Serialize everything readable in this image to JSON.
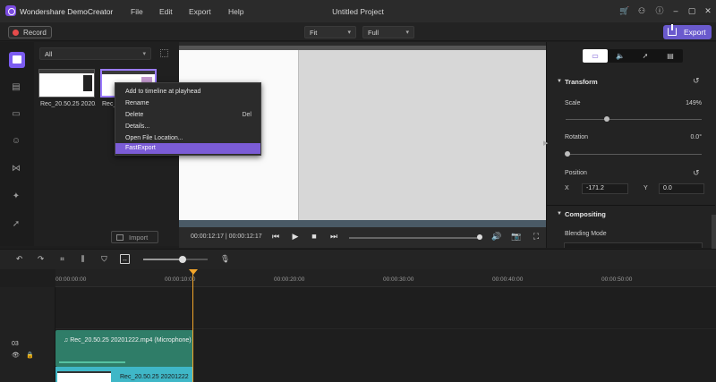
{
  "app": {
    "name": "Wondershare DemoCreator",
    "project_title": "Untitled Project"
  },
  "menu": [
    "File",
    "Edit",
    "Export",
    "Help"
  ],
  "toolbar": {
    "record_label": "Record",
    "fit_value": "Fit",
    "full_value": "Full",
    "export_label": "Export"
  },
  "media": {
    "filter_value": "All",
    "items": [
      {
        "label": "Rec_20.50.25 2020..."
      },
      {
        "label": "Rec_20.50.25 2020..."
      }
    ],
    "import_label": "Import"
  },
  "context_menu": {
    "items": [
      {
        "label": "Add to timeline at playhead",
        "shortcut": ""
      },
      {
        "label": "Rename",
        "shortcut": ""
      },
      {
        "label": "Delete",
        "shortcut": "Del"
      },
      {
        "label": "Details...",
        "shortcut": ""
      },
      {
        "label": "Open File Location...",
        "shortcut": ""
      },
      {
        "label": "FastExport",
        "shortcut": ""
      }
    ],
    "highlighted_index": 5
  },
  "player": {
    "timecode": "00:00:12:17 | 00:00:12:17"
  },
  "properties": {
    "transform_title": "Transform",
    "scale_label": "Scale",
    "scale_value": "149%",
    "rotation_label": "Rotation",
    "rotation_value": "0.0°",
    "position_label": "Position",
    "x_label": "X",
    "x_value": "-171.2",
    "y_label": "Y",
    "y_value": "0.0",
    "compositing_title": "Compositing",
    "blending_label": "Blending Mode"
  },
  "timeline": {
    "ticks": [
      "00:00:00:00",
      "00:00:10:00",
      "00:00:20:00",
      "00:00:30:00",
      "00:00:40:00",
      "00:00:50:00"
    ],
    "track_number": "03",
    "audio_clip_label": "Rec_20.50.25 20201222.mp4 (Microphone)",
    "video_clip_label": "Rec_20.50.25 20201222"
  },
  "colors": {
    "accent": "#6a5acd",
    "playhead": "#f2a52a",
    "audio_clip": "#2f7d68",
    "video_clip": "#3fb7c7"
  }
}
